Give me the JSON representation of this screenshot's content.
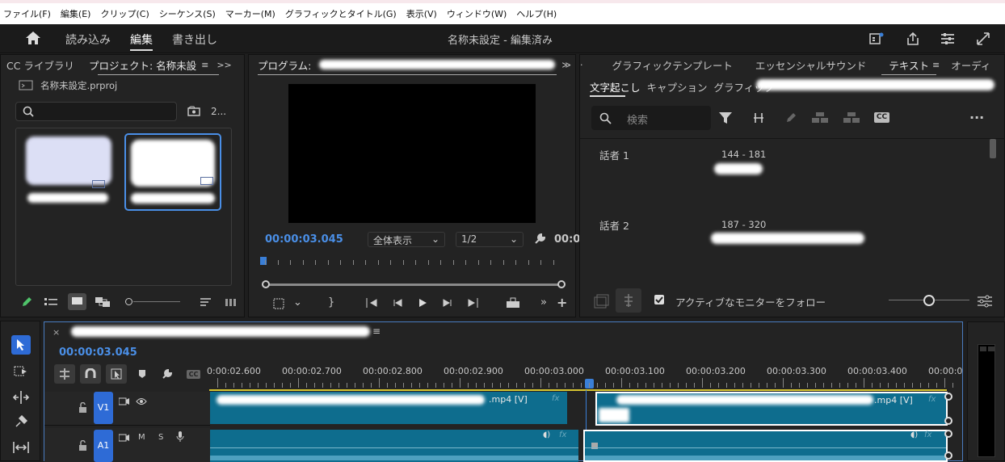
{
  "menu": [
    "ファイル(F)",
    "編集(E)",
    "クリップ(C)",
    "シーケンス(S)",
    "マーカー(M)",
    "グラフィックとタイトル(G)",
    "表示(V)",
    "ウィンドウ(W)",
    "ヘルプ(H)"
  ],
  "header": {
    "tabs": [
      "読み込み",
      "編集",
      "書き出し"
    ],
    "active_tab": "編集",
    "title": "名称未設定 - 編集済み"
  },
  "project_panel": {
    "tabs": [
      "CC ライブラリ",
      "プロジェクト: 名称未設",
      ">>"
    ],
    "file": "名称未設定.prproj",
    "count": "2..."
  },
  "program_panel": {
    "tab": "プログラム:",
    "timecode": "00:00:03.045",
    "zoom_select": "全体表示",
    "res_select": "1/2",
    "duration_partial": "00:0"
  },
  "text_panel": {
    "top_tabs": [
      "グラフィックテンプレート",
      "エッセンシャルサウンド",
      "テキスト",
      "オーディ"
    ],
    "sub_tabs": [
      "文字起こし",
      "キャプション",
      "グラフィック"
    ],
    "search_placeholder": "検索",
    "entries": [
      {
        "speaker": "話者 1",
        "range": "144 - 181"
      },
      {
        "speaker": "話者 2",
        "range": "187 - 320"
      }
    ],
    "follow_label": "アクティブなモニターをフォロー"
  },
  "timeline": {
    "timecode": "00:00:03.045",
    "ruler": [
      "0:00:02.600",
      "00:00:02.700",
      "00:00:02.800",
      "00:00:02.900",
      "00:00:03.000",
      "00:00:03.100",
      "00:00:03.200",
      "00:00:03.300",
      "00:00:03.400",
      "00:00:0"
    ],
    "v1": "V1",
    "a1": "A1",
    "clip_suffix": ".mp4 [V]",
    "fx": "fx",
    "m": "M",
    "s": "S"
  },
  "colors": {
    "accent": "#3a7fd7",
    "timecode": "#4a8fe7",
    "track_clip": "#0e6d8e",
    "selected_track": "#2e6bd6"
  }
}
